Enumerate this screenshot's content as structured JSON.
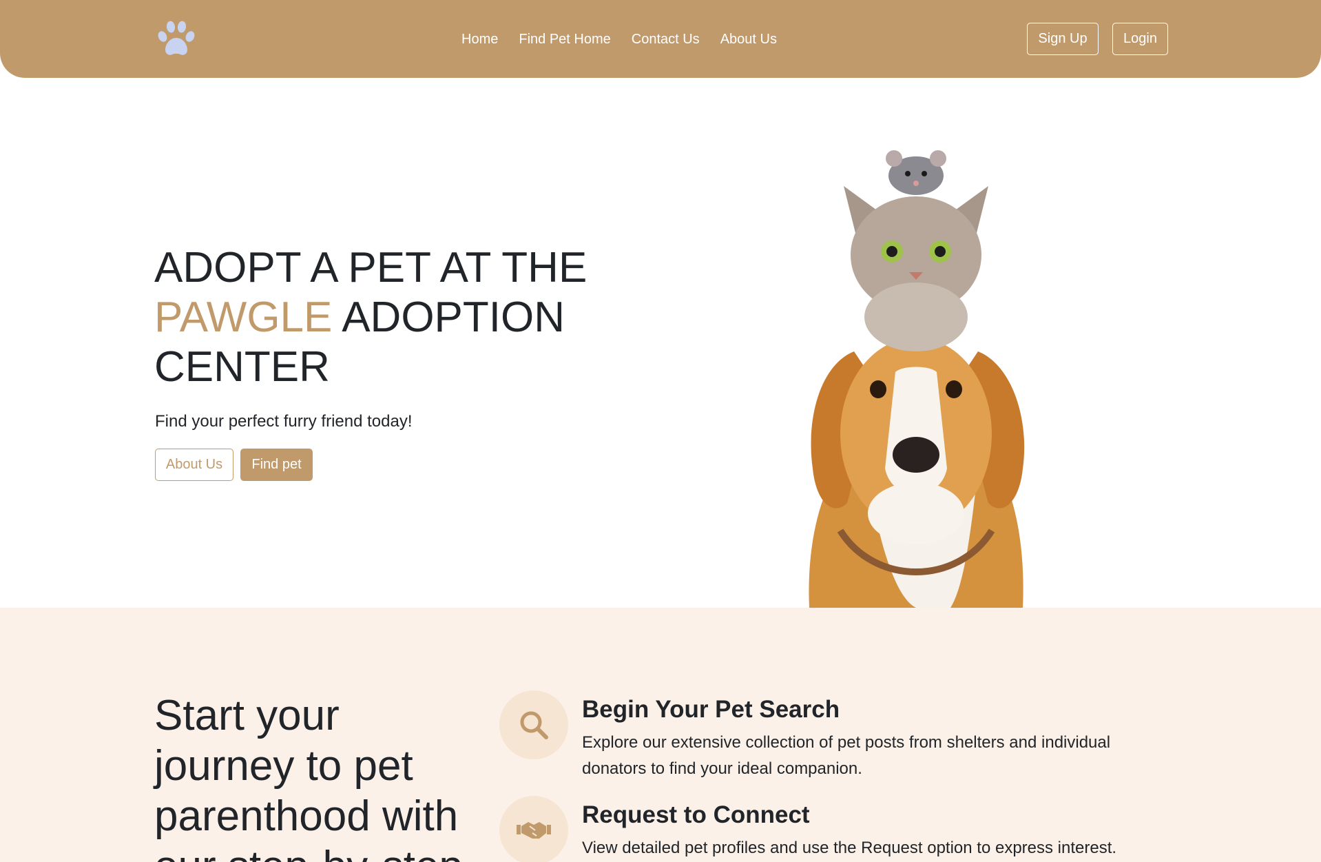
{
  "nav": {
    "logo_icon": "paw-icon",
    "links": [
      "Home",
      "Find Pet Home",
      "Contact Us",
      "About Us"
    ],
    "signup_label": "Sign Up",
    "login_label": "Login"
  },
  "hero": {
    "title_part1": "ADOPT A PET AT THE ",
    "title_accent": "PAWGLE",
    "title_part2": " ADOPTION CENTER",
    "subtitle": "Find your perfect furry friend today!",
    "about_button": "About Us",
    "find_button": "Find pet",
    "image": "pet-stack-illustration"
  },
  "journey": {
    "title": "Start your journey to pet parenthood with our step-by-step",
    "steps": [
      {
        "icon": "search-icon",
        "title": "Begin Your Pet Search",
        "description": "Explore our extensive collection of pet posts from shelters and individual donators to find your ideal companion."
      },
      {
        "icon": "handshake-icon",
        "title": "Request to Connect",
        "description": "View detailed pet profiles and use the Request option to express interest."
      }
    ]
  },
  "colors": {
    "brand": "#c19a6b",
    "section_bg": "#fbf1e8",
    "icon_circle": "#f6e5d3",
    "text": "#212529"
  }
}
